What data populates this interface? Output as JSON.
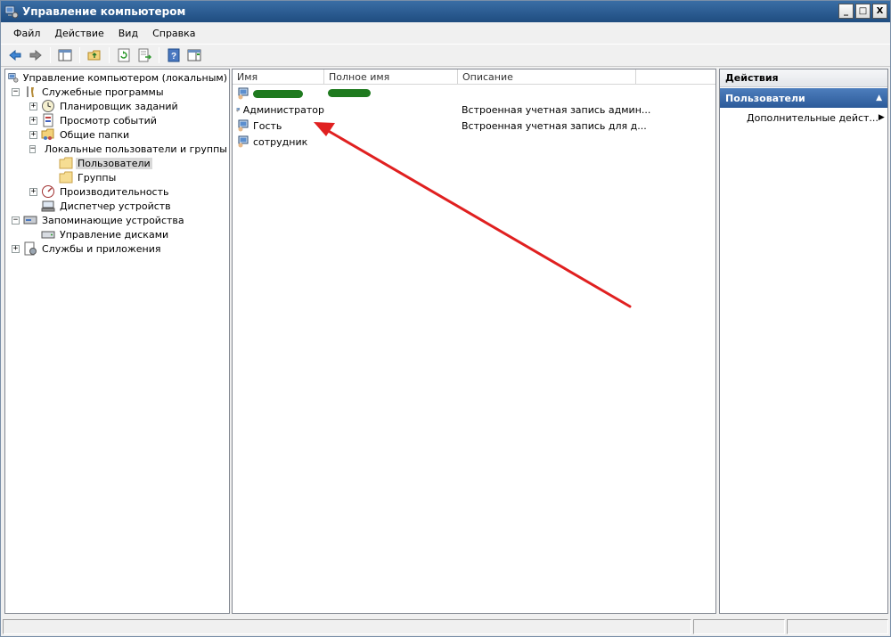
{
  "window": {
    "title": "Управление компьютером"
  },
  "window_buttons": {
    "minimize": "_",
    "maximize": "□",
    "close": "X"
  },
  "menu": {
    "items": [
      "Файл",
      "Действие",
      "Вид",
      "Справка"
    ]
  },
  "toolbar": {
    "buttons": [
      {
        "icon": "back-arrow-icon"
      },
      {
        "icon": "forward-arrow-icon"
      },
      {
        "icon": "show-hide-console-tree-icon"
      },
      {
        "icon": "up-folder-icon"
      },
      {
        "icon": "refresh-icon"
      },
      {
        "icon": "export-list-icon"
      },
      {
        "icon": "help-icon"
      },
      {
        "icon": "show-hide-action-pane-icon"
      }
    ]
  },
  "tree": {
    "root": "Управление компьютером (локальным)",
    "system_tools": "Служебные программы",
    "task_scheduler": "Планировщик заданий",
    "event_viewer": "Просмотр событий",
    "shared_folders": "Общие папки",
    "local_users_groups": "Локальные пользователи и группы",
    "users": "Пользователи",
    "groups": "Группы",
    "performance": "Производительность",
    "device_manager": "Диспетчер устройств",
    "storage": "Запоминающие устройства",
    "disk_management": "Управление дисками",
    "services_apps": "Службы и приложения"
  },
  "list": {
    "columns": {
      "name": "Имя",
      "full_name": "Полное имя",
      "description": "Описание"
    },
    "rows": [
      {
        "name": "",
        "full_name": "",
        "description": "",
        "redacted": true
      },
      {
        "name": "Администратор",
        "full_name": "",
        "description": "Встроенная учетная запись админ...",
        "redacted": false
      },
      {
        "name": "Гость",
        "full_name": "",
        "description": "Встроенная учетная запись для д...",
        "redacted": false
      },
      {
        "name": "сотрудник",
        "full_name": "",
        "description": "",
        "redacted": false
      }
    ]
  },
  "actions": {
    "header": "Действия",
    "section": "Пользователи",
    "section_arrow": "▲",
    "more": "Дополнительные дейст...",
    "more_arrow": "▶"
  },
  "colors": {
    "annotation_arrow": "#e02020",
    "redaction_scribble": "#1f7a1f",
    "actions_section_bg": "#3a6aa8"
  }
}
